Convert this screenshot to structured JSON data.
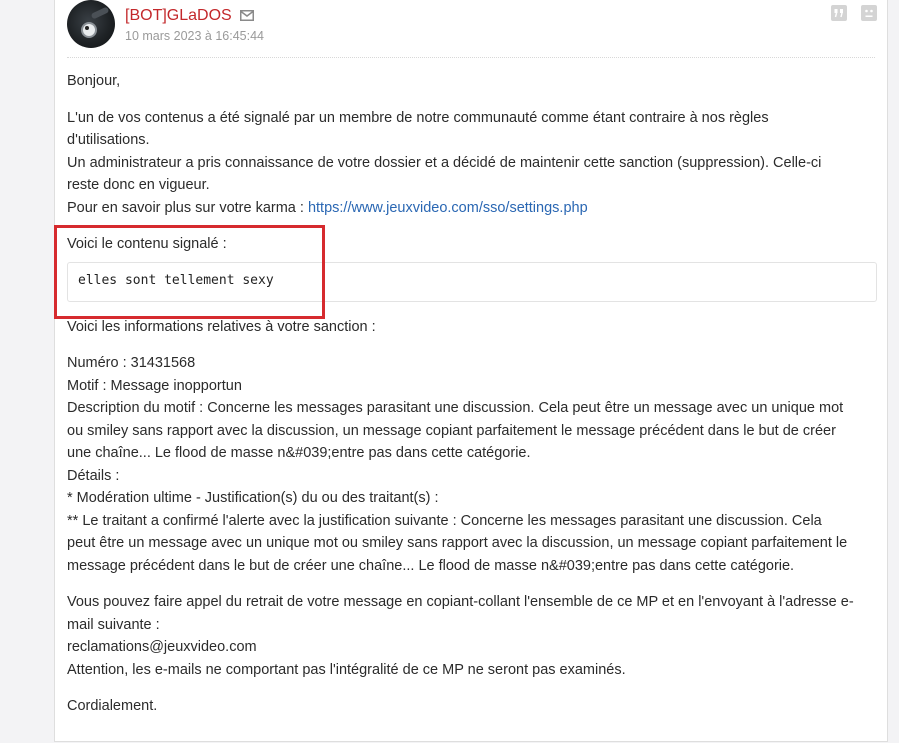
{
  "message": {
    "author": "[BOT]GLaDOS",
    "date": "10 mars 2023 à 16:45:44",
    "icons": {
      "mail": "envelope-icon",
      "quote": "quote-icon",
      "report": "report-icon"
    },
    "greeting": "Bonjour,",
    "intro_lines": [
      "L'un de vos contenus a été signalé par un membre de notre communauté comme étant contraire à nos règles",
      "d'utilisations.",
      "Un administrateur a pris connaissance de votre dossier et a décidé de maintenir cette sanction (suppression). Celle-ci",
      "reste donc en vigueur."
    ],
    "karma_prefix": "Pour en savoir plus sur votre karma : ",
    "karma_link": "https://www.jeuxvideo.com/sso/settings.php",
    "reported_label": "Voici le contenu signalé :",
    "reported_content": "elles sont tellement sexy",
    "sanction_intro": "Voici les informations relatives à votre sanction :",
    "sanction_lines": [
      "Numéro : 31431568",
      "Motif : Message inopportun",
      "Description du motif : Concerne les messages parasitant une discussion. Cela peut être un message avec un unique mot",
      "ou smiley sans rapport avec la discussion, un message copiant parfaitement le message précédent dans le but de créer",
      "une chaîne... Le flood de masse n&#039;entre pas dans cette catégorie.",
      "Détails :",
      "* Modération ultime - Justification(s) du ou des traitant(s) :",
      "** Le traitant a confirmé l'alerte avec la justification suivante : Concerne les messages parasitant une discussion. Cela",
      "peut être un message avec un unique mot ou smiley sans rapport avec la discussion, un message copiant parfaitement le",
      "message précédent dans le but de créer une chaîne... Le flood de masse n&#039;entre pas dans cette catégorie."
    ],
    "appeal_lines": [
      "Vous pouvez faire appel du retrait de votre message en copiant-collant l'ensemble de ce MP et en l'envoyant à l'adresse e-",
      "mail suivante :",
      "reclamations@jeuxvideo.com",
      "Attention, les e-mails ne comportant pas l'intégralité de ce MP ne seront pas examinés."
    ],
    "closing": "Cordialement."
  },
  "colors": {
    "author": "#c3282b",
    "link": "#2a67b3",
    "highlight_box": "#d62a2e"
  }
}
